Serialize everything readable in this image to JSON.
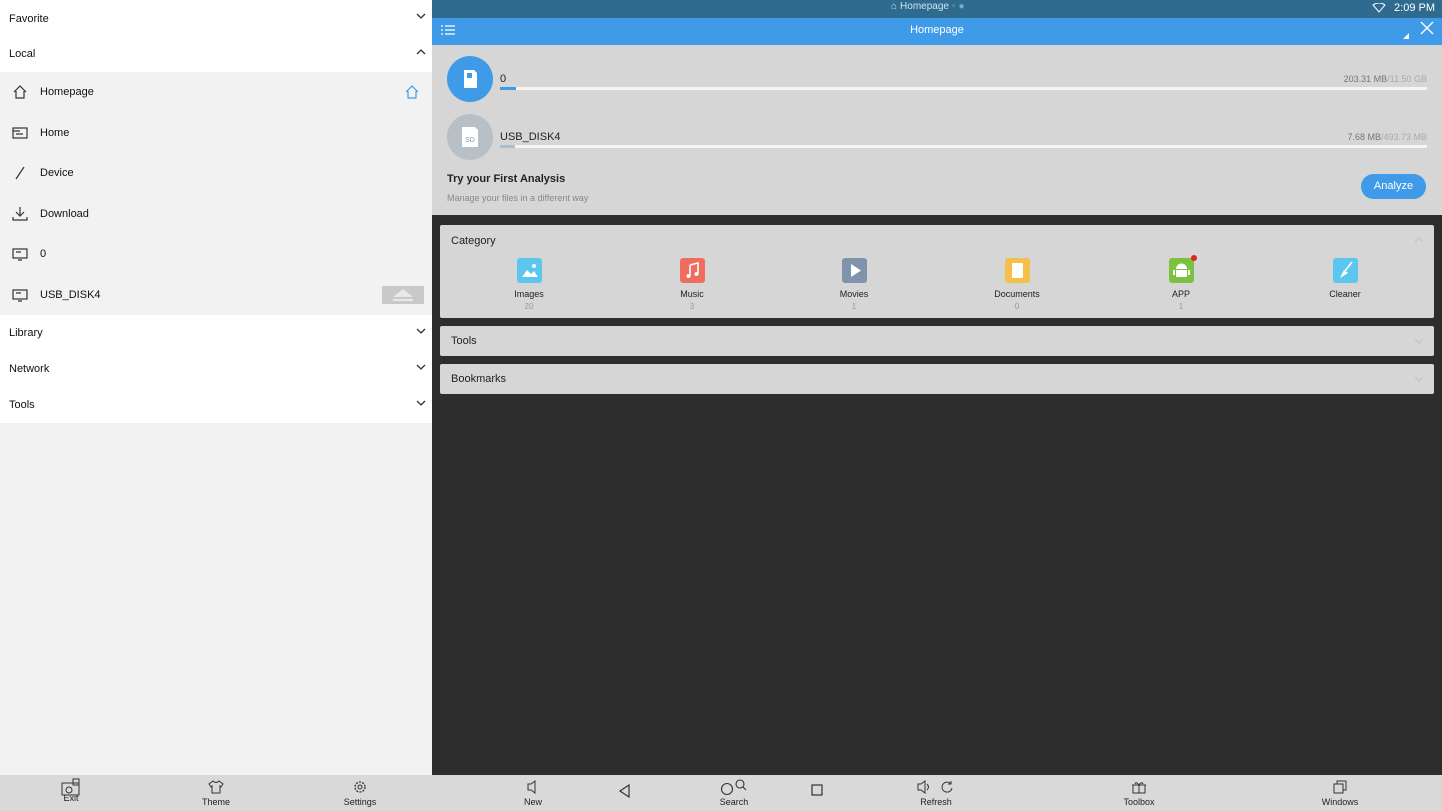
{
  "status_bar": {
    "title": "Homepage",
    "time": "2:09 PM"
  },
  "drawer": {
    "favorite_label": "Favorite",
    "local_label": "Local",
    "local_items": [
      {
        "label": "Homepage",
        "icon": "home-outline-icon"
      },
      {
        "label": "Home",
        "icon": "folder-icon"
      },
      {
        "label": "Device",
        "icon": "slash-icon"
      },
      {
        "label": "Download",
        "icon": "download-icon"
      },
      {
        "label": "0",
        "icon": "storage-icon"
      },
      {
        "label": "USB_DISK4",
        "icon": "storage-icon"
      }
    ],
    "library_label": "Library",
    "network_label": "Network",
    "tools_label": "Tools"
  },
  "appbar": {
    "title": "Homepage"
  },
  "storage": [
    {
      "name": "0",
      "used": "203.31 MB",
      "total": "/11.50 GB",
      "fraction": 0.017,
      "color": "#3f9be8",
      "icon": "sd-card-icon"
    },
    {
      "name": "USB_DISK4",
      "used": "7.68 MB",
      "total": "/493.73 MB",
      "fraction": 0.016,
      "color": "#a7bfd3",
      "icon": "sd-card-icon"
    }
  ],
  "analysis": {
    "title": "Try your First Analysis",
    "subtitle": "Manage your files in a different way",
    "button": "Analyze"
  },
  "category": {
    "title": "Category",
    "items": [
      {
        "label": "Images",
        "count": "20",
        "color": "#5bc6ee",
        "icon": "image-icon"
      },
      {
        "label": "Music",
        "count": "3",
        "color": "#f06d5e",
        "icon": "music-icon"
      },
      {
        "label": "Movies",
        "count": "1",
        "color": "#7f93ac",
        "icon": "play-icon"
      },
      {
        "label": "Documents",
        "count": "0",
        "color": "#f4bf4a",
        "icon": "document-icon"
      },
      {
        "label": "APP",
        "count": "1",
        "color": "#7dc143",
        "icon": "android-icon"
      },
      {
        "label": "Cleaner",
        "count": "",
        "color": "#5bc6ee",
        "icon": "broom-icon"
      }
    ]
  },
  "tools_card": {
    "title": "Tools"
  },
  "bookmarks_card": {
    "title": "Bookmarks"
  },
  "bottom_bar": {
    "exit": "Exit",
    "theme": "Theme",
    "settings": "Settings",
    "new": "New",
    "search": "Search",
    "refresh": "Refresh",
    "toolbox": "Toolbox",
    "windows": "Windows"
  }
}
